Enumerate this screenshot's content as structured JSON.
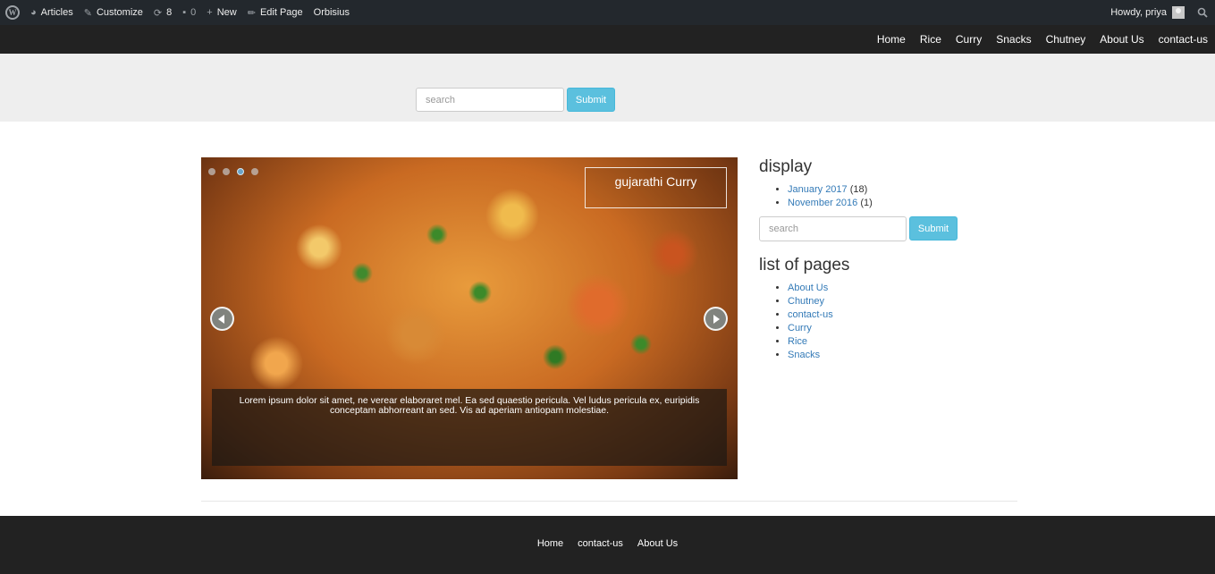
{
  "adminbar": {
    "items": [
      {
        "label": "Articles"
      },
      {
        "label": "Customize"
      },
      {
        "label": "8"
      },
      {
        "label": "0"
      },
      {
        "label": "New"
      },
      {
        "label": "Edit Page"
      },
      {
        "label": "Orbisius"
      }
    ],
    "greeting": "Howdy, priya"
  },
  "nav": [
    "Home",
    "Rice",
    "Curry",
    "Snacks",
    "Chutney",
    "About Us",
    "contact-us"
  ],
  "top_search": {
    "placeholder": "search",
    "button": "Submit"
  },
  "slider": {
    "title": "gujarathi Curry",
    "caption": "Lorem ipsum dolor sit amet, ne verear elaboraret mel. Ea sed quaestio pericula. Vel ludus pericula ex, euripidis conceptam abhorreant an sed. Vis ad aperiam antiopam molestiae.",
    "dots": 4,
    "active_dot": 3
  },
  "sidebar": {
    "display_title": "display",
    "archives": [
      {
        "label": "January 2017",
        "count": "(18)"
      },
      {
        "label": "November 2016",
        "count": "(1)"
      }
    ],
    "search": {
      "placeholder": "search",
      "button": "Submit"
    },
    "pages_title": "list of pages",
    "pages": [
      "About Us",
      "Chutney",
      "contact-us",
      "Curry",
      "Rice",
      "Snacks"
    ]
  },
  "footer": [
    "Home",
    "contact-us",
    "About Us"
  ],
  "colors": {
    "admin_bg": "#23282d",
    "nav_bg": "#222222",
    "link": "#337ab7",
    "button": "#5bc0de"
  }
}
